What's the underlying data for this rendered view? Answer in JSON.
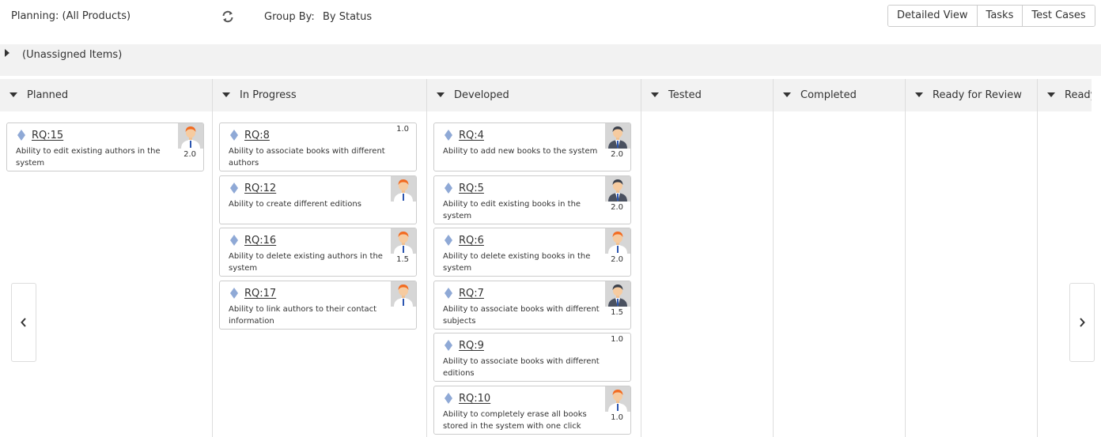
{
  "header": {
    "title": "Planning: (All Products)",
    "group_by_label": "Group By:",
    "group_by_value": "By Status",
    "views": [
      "Detailed View",
      "Tasks",
      "Test Cases"
    ]
  },
  "unassigned": {
    "label": "(Unassigned Items)"
  },
  "columns": [
    {
      "title": "Planned",
      "cards": [
        {
          "id": "RQ:15",
          "desc": "Ability to edit existing authors in the system",
          "est": "2.0",
          "avatar": "orange"
        }
      ]
    },
    {
      "title": "In Progress",
      "cards": [
        {
          "id": "RQ:8",
          "desc": "Ability to associate books with different authors",
          "est": "1.0",
          "avatar": ""
        },
        {
          "id": "RQ:12",
          "desc": "Ability to create different editions",
          "est": "",
          "avatar": "orange"
        },
        {
          "id": "RQ:16",
          "desc": "Ability to delete existing authors in the system",
          "est": "1.5",
          "avatar": "orange"
        },
        {
          "id": "RQ:17",
          "desc": "Ability to link authors to their contact information",
          "est": "",
          "avatar": "orange"
        }
      ]
    },
    {
      "title": "Developed",
      "cards": [
        {
          "id": "RQ:4",
          "desc": "Ability to add new books to the system",
          "est": "2.0",
          "avatar": "dark"
        },
        {
          "id": "RQ:5",
          "desc": "Ability to edit existing books in the system",
          "est": "2.0",
          "avatar": "dark"
        },
        {
          "id": "RQ:6",
          "desc": "Ability to delete existing books in the system",
          "est": "2.0",
          "avatar": "orange"
        },
        {
          "id": "RQ:7",
          "desc": "Ability to associate books with different subjects",
          "est": "1.5",
          "avatar": "dark"
        },
        {
          "id": "RQ:9",
          "desc": "Ability to associate books with different editions",
          "est": "1.0",
          "avatar": ""
        },
        {
          "id": "RQ:10",
          "desc": "Ability to completely erase all books stored in the system with one click",
          "est": "1.0",
          "avatar": "orange"
        }
      ]
    },
    {
      "title": "Tested",
      "cards": []
    },
    {
      "title": "Completed",
      "cards": []
    },
    {
      "title": "Ready for Review",
      "cards": []
    },
    {
      "title": "Ready for Test",
      "cards": []
    }
  ],
  "colors": {
    "header_bg": "#f2f2f2",
    "card_border": "#cccccc",
    "diamond": "#8fa9d6",
    "avatar_orange_hair": "#f26b21",
    "avatar_dark_hair": "#3a3f4a"
  },
  "icons": {
    "refresh": "refresh-icon",
    "requirement": "diamond-icon",
    "prev": "chevron-left-icon",
    "next": "chevron-right-icon"
  }
}
